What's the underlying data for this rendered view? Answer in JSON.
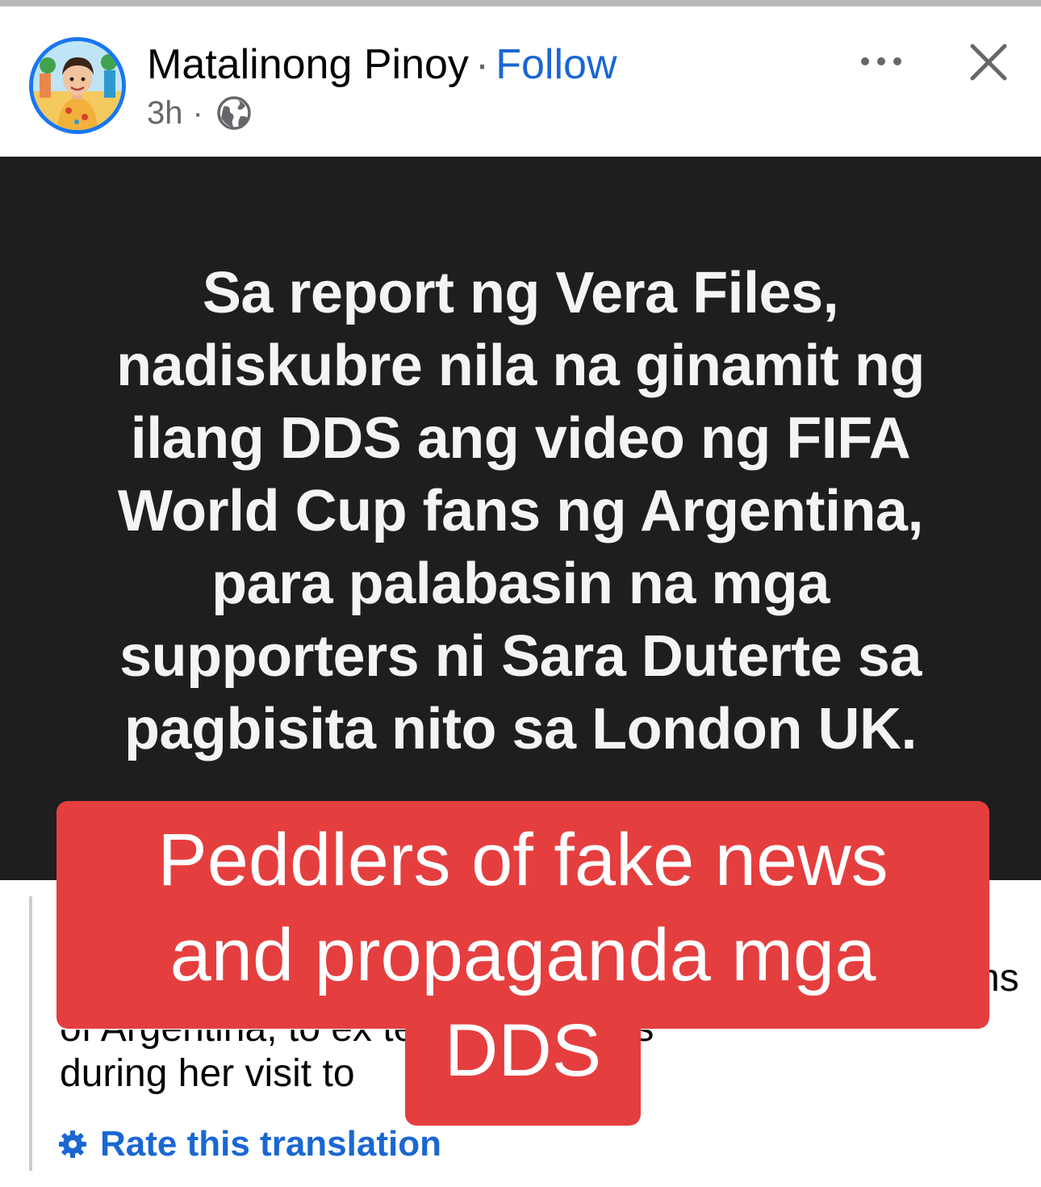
{
  "post": {
    "author": "Matalinong Pinoy",
    "separator": "·",
    "follow_label": "Follow",
    "time": "3h",
    "meta_separator": "·",
    "privacy_icon": "globe-icon",
    "more_icon": "more-icon",
    "close_icon": "close-icon"
  },
  "text_post": {
    "background": "#1e1e1e",
    "lines": [
      "Sa report ng Vera Files,",
      "nadiskubre nila na ginamit ng",
      "ilang DDS ang video ng FIFA",
      "World Cup fans ng Argentina,",
      "para palabasin na mga",
      "supporters ni Sara Duterte sa",
      "pagbisita nito sa London UK."
    ]
  },
  "translation": {
    "visible_fragments": {
      "line_end_fragment": "ns",
      "partial_line": "of Argentina, to ex                 terte supporters",
      "last_line": "during her visit to"
    },
    "rate_label": "Rate this translation",
    "rate_icon": "gear-icon"
  },
  "caption_overlay": {
    "color": "#e53e3f",
    "lines": [
      "Peddlers of fake news",
      "and propaganda mga",
      "DDS"
    ]
  },
  "colors": {
    "accent": "#1a67d2",
    "avatar_ring": "#1877f2",
    "secondary_text": "#65676b"
  }
}
